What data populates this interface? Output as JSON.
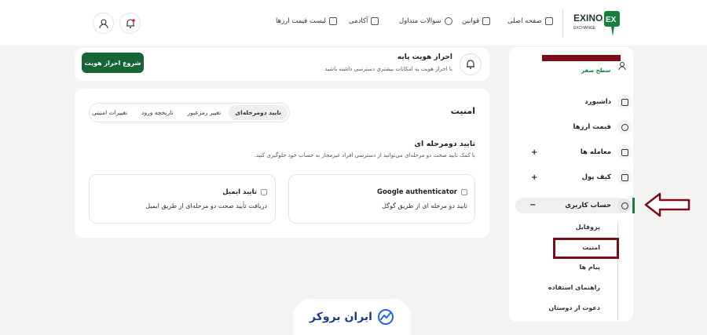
{
  "header": {
    "logo": {
      "word": "EXINO",
      "sub": "EXCHANGE",
      "mark": "EX"
    },
    "nav": [
      {
        "label": "صفحه اصلی",
        "icon": "home-icon"
      },
      {
        "label": "قوانین",
        "icon": "rules-icon"
      },
      {
        "label": "سوالات متداول",
        "icon": "question-icon"
      },
      {
        "label": "آکادمی",
        "icon": "academy-icon"
      },
      {
        "label": "لیست قیمت ارزها",
        "icon": "chart-icon"
      }
    ]
  },
  "sidebar": {
    "user_level": "سطح صفر",
    "items": [
      {
        "label": "داشبورد",
        "icon": "dashboard-icon"
      },
      {
        "label": "قیمت ارزها",
        "icon": "price-icon"
      },
      {
        "label": "معامله ها",
        "icon": "trade-icon",
        "expand": "+"
      },
      {
        "label": "کیف پول",
        "icon": "wallet-icon",
        "expand": "+"
      },
      {
        "label": "حساب کاربری",
        "icon": "user-icon",
        "expand": "−"
      }
    ],
    "sub_items": [
      "پروفایل",
      "امنیت",
      "پیام ها",
      "راهنمای استفاده",
      "دعوت از دوستان"
    ]
  },
  "banner": {
    "title": "احراز هویت پایه",
    "subtitle": "با احراز هویت به امکانات بیشتری دسترسی داشته باشید",
    "button": "شروع احراز هویت"
  },
  "security": {
    "title": "امنیت",
    "tabs": [
      "تایید دومرحله‌ای",
      "تغییر رمزعبور",
      "تاریخچه ورود",
      "تغییرات امنیتی"
    ],
    "section_title": "تایید دومرحله ای",
    "section_desc": "با کمک تایید صحت دو مرحله‌ای می‌توانید از دسترسی افراد غیرمجاز به حساب خود جلوگیری کنید.",
    "options": [
      {
        "title": "Google authenticator",
        "desc": "تایید دو مرحله ای از طریق گوگل"
      },
      {
        "title": "تایید ایمیل",
        "desc": "دریافت تأیید صحت دو مرحله‌ای از طریق ایمیل"
      }
    ]
  },
  "brand": {
    "name": "ایران بروکر"
  },
  "colors": {
    "primary": "#166534",
    "highlight": "#7a0d18",
    "brand": "#1e3a8a"
  }
}
